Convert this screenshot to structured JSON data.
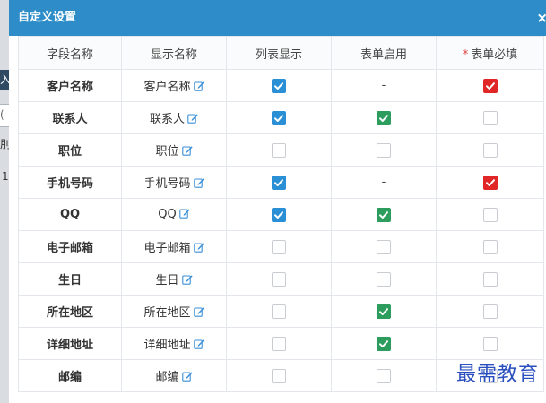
{
  "dialog": {
    "title": "自定义设置",
    "close": "×"
  },
  "background": {
    "tab1": "入",
    "tab2": "(",
    "tab3": "刖",
    "tab4": "1"
  },
  "table": {
    "headers": [
      "字段名称",
      "显示名称",
      "列表显示",
      "表单启用",
      "表单必填"
    ],
    "required_mark": "*",
    "rows": [
      {
        "field": "客户名称",
        "display": "客户名称",
        "list": "checked-blue",
        "form": "dash",
        "required": "checked-red"
      },
      {
        "field": "联系人",
        "display": "联系人",
        "list": "checked-blue",
        "form": "checked-green",
        "required": "unchecked"
      },
      {
        "field": "职位",
        "display": "职位",
        "list": "unchecked",
        "form": "unchecked",
        "required": "unchecked"
      },
      {
        "field": "手机号码",
        "display": "手机号码",
        "list": "checked-blue",
        "form": "dash",
        "required": "checked-red"
      },
      {
        "field": "QQ",
        "display": "QQ",
        "list": "checked-blue",
        "form": "checked-green",
        "required": "unchecked"
      },
      {
        "field": "电子邮箱",
        "display": "电子邮箱",
        "list": "unchecked",
        "form": "unchecked",
        "required": "unchecked"
      },
      {
        "field": "生日",
        "display": "生日",
        "list": "unchecked",
        "form": "unchecked",
        "required": "unchecked"
      },
      {
        "field": "所在地区",
        "display": "所在地区",
        "list": "unchecked",
        "form": "checked-green",
        "required": "unchecked"
      },
      {
        "field": "详细地址",
        "display": "详细地址",
        "list": "unchecked",
        "form": "checked-green",
        "required": "unchecked"
      },
      {
        "field": "邮编",
        "display": "邮编",
        "list": "unchecked",
        "form": "unchecked",
        "required": "unchecked"
      }
    ],
    "dash_text": "-"
  },
  "watermark": "最需教育",
  "colors": {
    "titlebar": "#2e8dc8",
    "check_blue": "#2b8fd6",
    "check_green": "#2d9d5e",
    "check_red": "#e02626",
    "edit_icon": "#3a8fd8",
    "watermark": "#2a4fbf"
  }
}
